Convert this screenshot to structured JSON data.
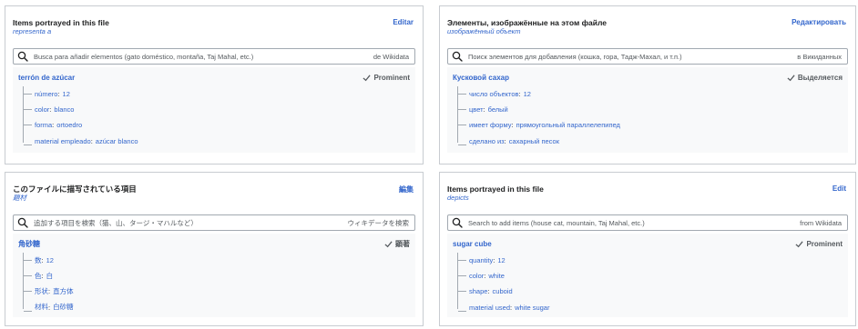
{
  "colors": {
    "link": "#3366cc",
    "border": "#c8ccd1",
    "muted": "#54595d",
    "body_bg": "#f8f9fa"
  },
  "icons": {
    "search": "search-icon",
    "check": "check-icon"
  },
  "panels": [
    {
      "title": "Items portrayed in this file",
      "subtitle": "representa a",
      "edit": "Editar",
      "placeholder": "Busca para añadir elementos (gato doméstico, montaña, Taj Mahal, etc.)",
      "source": "de Wikidata",
      "item": "terrón de azúcar",
      "prominent": "Prominent",
      "qualifiers": [
        {
          "prop": "número",
          "sep": ":",
          "value": "12"
        },
        {
          "prop": "color",
          "sep": ":",
          "value": "blanco"
        },
        {
          "prop": "forma",
          "sep": ":",
          "value": "ortoedro"
        },
        {
          "prop": "material empleado",
          "sep": ":",
          "value": "azúcar blanco"
        }
      ]
    },
    {
      "title": "Элементы, изображённые на этом файле",
      "subtitle": "изображённый объект",
      "edit": "Редактировать",
      "placeholder": "Поиск элементов для добавления (кошка, гора, Тадж-Махал, и т.п.)",
      "source": "в Викиданных",
      "item": "Кусковой сахар",
      "prominent": "Выделяется",
      "qualifiers": [
        {
          "prop": "число объектов",
          "sep": ":",
          "value": "12"
        },
        {
          "prop": "цвет",
          "sep": ":",
          "value": "белый"
        },
        {
          "prop": "имеет форму",
          "sep": ":",
          "value": "прямоугольный параллелепипед"
        },
        {
          "prop": "сделано из",
          "sep": ":",
          "value": "сахарный песок"
        }
      ]
    },
    {
      "title": "このファイルに描写されている項目",
      "subtitle": "題材",
      "edit": "編集",
      "placeholder": "追加する項目を検索（猫、山、タージ・マハルなど）",
      "source": "ウィキデータを検索",
      "item": "角砂糖",
      "prominent": "顕著",
      "qualifiers": [
        {
          "prop": "数",
          "sep": ":",
          "value": "12"
        },
        {
          "prop": "色",
          "sep": ":",
          "value": "白"
        },
        {
          "prop": "形状",
          "sep": ":",
          "value": "直方体"
        },
        {
          "prop": "材料",
          "sep": ":",
          "value": "白砂糖"
        }
      ]
    },
    {
      "title": "Items portrayed in this file",
      "subtitle": "depicts",
      "edit": "Edit",
      "placeholder": "Search to add items (house cat, mountain, Taj Mahal, etc.)",
      "source": "from Wikidata",
      "item": "sugar cube",
      "prominent": "Prominent",
      "qualifiers": [
        {
          "prop": "quantity",
          "sep": ":",
          "value": "12"
        },
        {
          "prop": "color",
          "sep": ":",
          "value": "white"
        },
        {
          "prop": "shape",
          "sep": ":",
          "value": "cuboid"
        },
        {
          "prop": "material used",
          "sep": ":",
          "value": "white sugar"
        }
      ]
    }
  ]
}
